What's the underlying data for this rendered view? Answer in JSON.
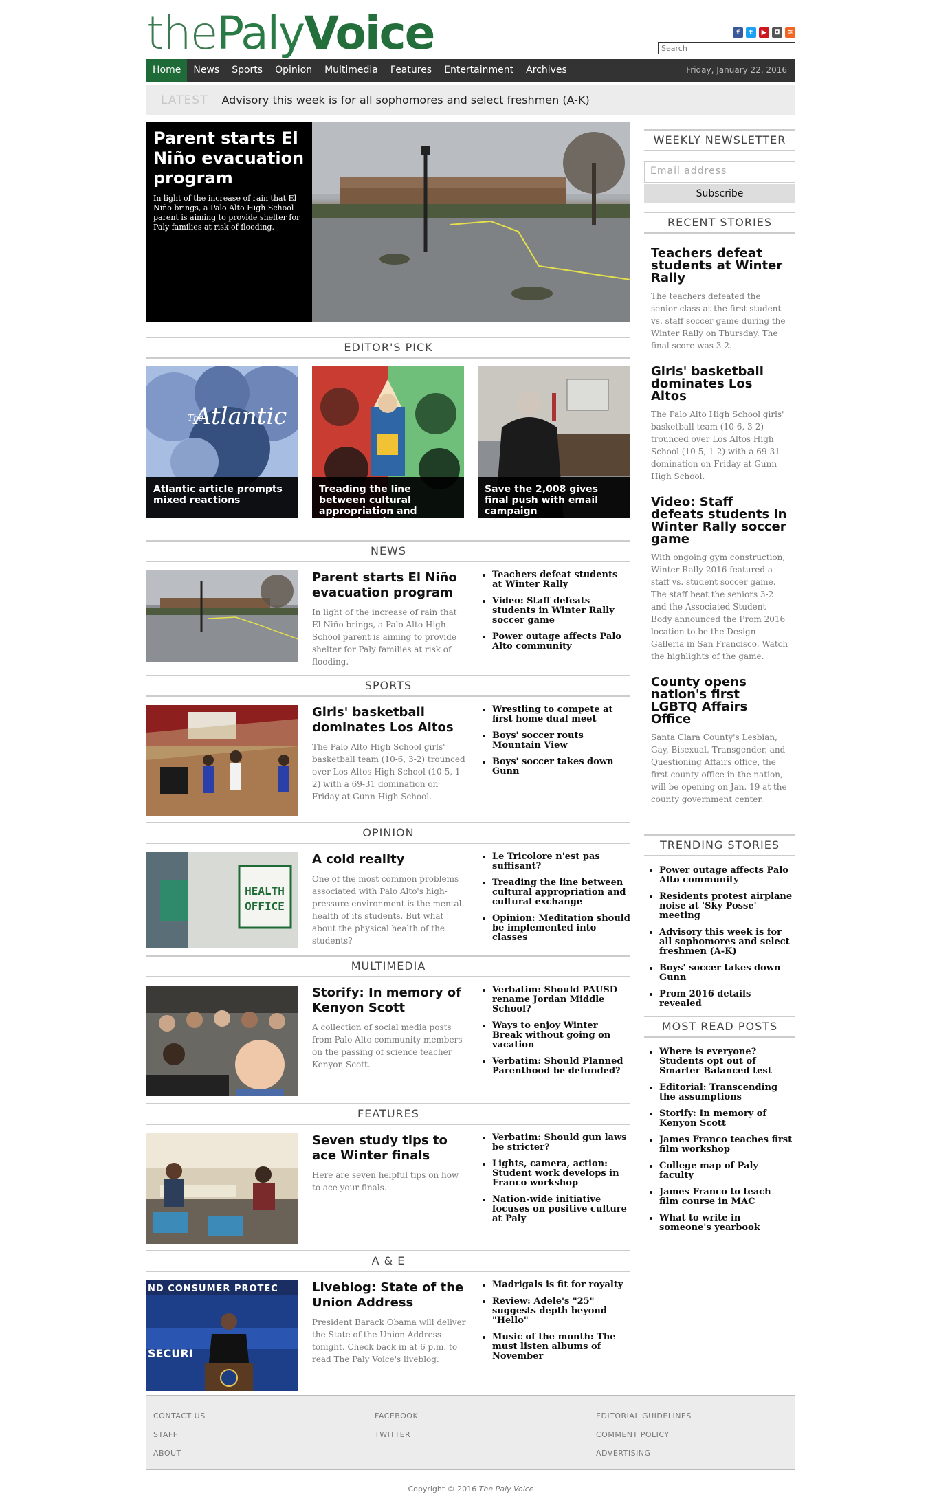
{
  "site": {
    "logo_the": "the",
    "logo_paly": "Paly",
    "logo_voice": "Voice"
  },
  "header": {
    "social": [
      "facebook-icon",
      "twitter-icon",
      "youtube-icon",
      "instagram-icon",
      "rss-icon"
    ],
    "search_placeholder": "Search"
  },
  "nav": {
    "items": [
      "Home",
      "News",
      "Sports",
      "Opinion",
      "Multimedia",
      "Features",
      "Entertainment",
      "Archives"
    ],
    "date": "Friday, January 22, 2016"
  },
  "latest": {
    "label": "LATEST",
    "text": "Advisory this week is for all sophomores and select freshmen (A-K)"
  },
  "hero": {
    "title": "Parent starts El Niño evacuation program",
    "summary": "In light of the increase of rain that El Niño brings, a Palo Alto High School parent is aiming to provide shelter for Paly families at risk of flooding."
  },
  "editors_pick": {
    "heading": "EDITOR'S PICK",
    "items": [
      {
        "caption": "Atlantic article prompts mixed reactions",
        "image_text": "Atlantic",
        "image_text_small": "The"
      },
      {
        "caption": "Treading the line between cultural appropriation and cultural exchange"
      },
      {
        "caption": "Save the 2,008 gives final push with email campaign"
      }
    ]
  },
  "sections": [
    {
      "heading": "NEWS",
      "title": "Parent starts El Niño evacuation program",
      "summary": "In light of the increase of rain that El Niño brings, a Palo Alto High School parent is aiming to provide shelter for Paly families at risk of flooding.",
      "links": [
        "Teachers defeat students at Winter Rally",
        "Video: Staff defeats students in Winter Rally soccer game",
        "Power outage affects Palo Alto community"
      ]
    },
    {
      "heading": "SPORTS",
      "title": "Girls' basketball dominates Los Altos",
      "summary": "The Palo Alto High School girls' basketball team (10-6, 3-2) trounced over Los Altos High School (10-5, 1-2) with a 69-31 domination on Friday at Gunn High School.",
      "links": [
        "Wrestling to compete at first home dual meet",
        "Boys' soccer routs Mountain View",
        "Boys' soccer takes down Gunn"
      ]
    },
    {
      "heading": "OPINION",
      "title": "A cold reality",
      "summary": "One of the most common problems associated with Palo Alto's high-pressure environment is the mental health of its students. But what about the physical health of the students?",
      "image_text": "HEALTH OFFICE",
      "links": [
        "Le Tricolore n'est pas suffisant?",
        "Treading the line between cultural appropriation and cultural exchange",
        "Opinion: Meditation should be implemented into classes"
      ]
    },
    {
      "heading": "MULTIMEDIA",
      "title": "Storify: In memory of Kenyon Scott",
      "summary": "A collection of social media posts from Palo Alto community members on the passing of science teacher Kenyon Scott.",
      "links": [
        "Verbatim: Should PAUSD rename Jordan Middle School?",
        "Ways to enjoy Winter Break without going on vacation",
        "Verbatim: Should Planned Parenthood be defunded?"
      ]
    },
    {
      "heading": "FEATURES",
      "title": "Seven study tips to ace Winter finals",
      "summary": "Here are seven helpful tips on how to ace your finals.",
      "links": [
        "Verbatim: Should gun laws be stricter?",
        "Lights, camera, action: Student work develops in Franco workshop",
        "Nation-wide initiative focuses on positive culture at Paly"
      ]
    },
    {
      "heading": "A & E",
      "title": "Liveblog: State of the Union Address",
      "summary": "President Barack Obama will deliver the State of the Union Address tonight. Check back in at 6 p.m. to read The Paly Voice's liveblog.",
      "image_text_top": "ND CONSUMER PROTEC",
      "image_text_bottom": "SECURI",
      "links": [
        "Madrigals is fit for royalty",
        "Review: Adele's \"25\" suggests depth beyond \"Hello\"",
        "Music of the month: The must listen albums of November"
      ]
    }
  ],
  "sidebar": {
    "newsletter_heading": "WEEKLY NEWSLETTER",
    "email_placeholder": "Email address",
    "subscribe_label": "Subscribe",
    "recent_heading": "RECENT STORIES",
    "recent": [
      {
        "title": "Teachers defeat students at Winter Rally",
        "summary": "The teachers defeated the senior class at the first student vs. staff soccer game during the Winter Rally on Thursday. The final score was 3-2."
      },
      {
        "title": "Girls' basketball dominates Los Altos",
        "summary": "The Palo Alto High School girls' basketball team (10-6, 3-2) trounced over Los Altos High School (10-5, 1-2) with a 69-31 domination on Friday at Gunn High School."
      },
      {
        "title": "Video: Staff defeats students in Winter Rally soccer game",
        "summary": "With ongoing gym construction, Winter Rally 2016 featured a staff vs. student soccer game. The staff beat the seniors 3-2 and the Associated Student Body announced the Prom 2016 location to be the Design Galleria in San Francisco. Watch the highlights of the game."
      },
      {
        "title": "County opens nation's first LGBTQ Affairs Office",
        "summary": "Santa Clara County's Lesbian, Gay, Bisexual, Transgender, and Questioning Affairs office, the first county office in the nation, will be opening on Jan. 19 at the county government center."
      }
    ],
    "trending_heading": "TRENDING STORIES",
    "trending": [
      "Power outage affects Palo Alto community",
      "Residents protest airplane noise at 'Sky Posse' meeting",
      "Advisory this week is for all sophomores and select freshmen (A-K)",
      "Boys' soccer takes down Gunn",
      "Prom 2016 details revealed"
    ],
    "mostread_heading": "MOST READ POSTS",
    "mostread": [
      "Where is everyone? Students opt out of Smarter Balanced test",
      "Editorial: Transcending the assumptions",
      "Storify: In memory of Kenyon Scott",
      "James Franco teaches first film workshop",
      "College map of Paly faculty",
      "James Franco to teach film course in MAC",
      "What to write in someone's yearbook"
    ]
  },
  "footer": {
    "col1": [
      "CONTACT US",
      "STAFF",
      "ABOUT"
    ],
    "col2": [
      "FACEBOOK",
      "TWITTER"
    ],
    "col3": [
      "EDITORIAL GUIDELINES",
      "COMMENT POLICY",
      "ADVERTISING"
    ],
    "copyright": "Copyright © 2016",
    "copyright_name": "The Paly Voice"
  }
}
